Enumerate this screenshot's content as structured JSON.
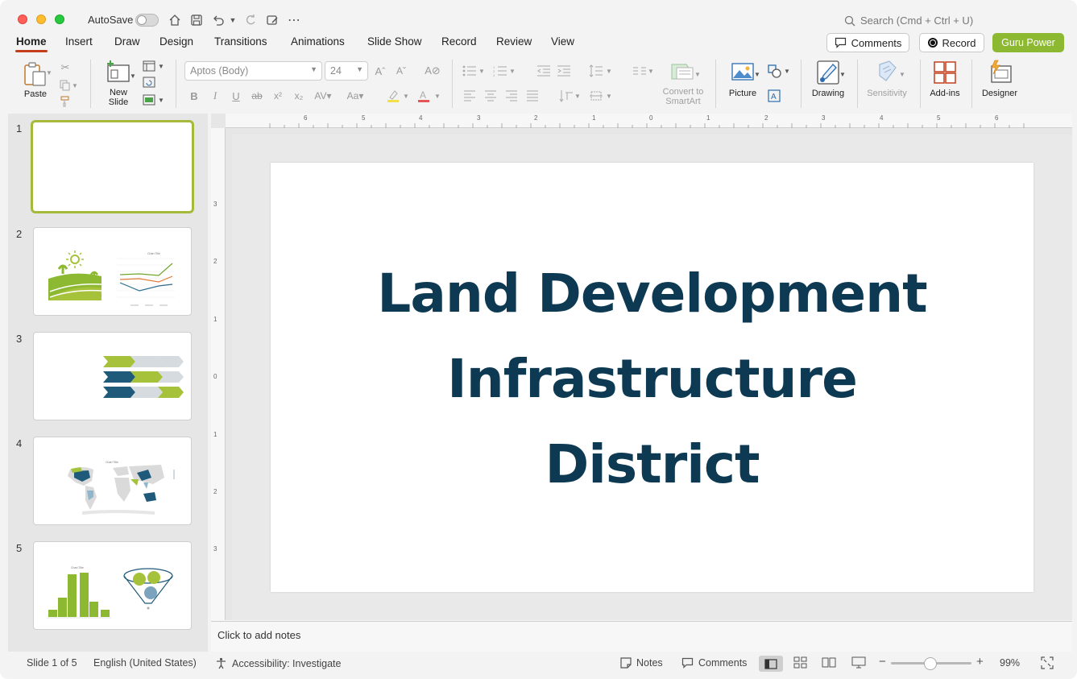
{
  "titlebar": {
    "autosave_label": "AutoSave",
    "search_placeholder": "Search (Cmd + Ctrl + U)"
  },
  "tabs": [
    {
      "label": "Home",
      "active": true
    },
    {
      "label": "Insert"
    },
    {
      "label": "Draw"
    },
    {
      "label": "Design"
    },
    {
      "label": "Transitions"
    },
    {
      "label": "Animations"
    },
    {
      "label": "Slide Show"
    },
    {
      "label": "Record"
    },
    {
      "label": "Review"
    },
    {
      "label": "View"
    }
  ],
  "header_buttons": {
    "comments": "Comments",
    "record": "Record",
    "guru": "Guru Power"
  },
  "ribbon": {
    "paste": "Paste",
    "new_slide_line1": "New",
    "new_slide_line2": "Slide",
    "font_name": "Aptos (Body)",
    "font_size": "24",
    "convert_line1": "Convert to",
    "convert_line2": "SmartArt",
    "picture": "Picture",
    "drawing": "Drawing",
    "sensitivity": "Sensitivity",
    "addins": "Add-ins",
    "designer": "Designer"
  },
  "ruler": {
    "h_labels": [
      "6",
      "5",
      "4",
      "3",
      "2",
      "1",
      "0",
      "1",
      "2",
      "3",
      "4",
      "5",
      "6"
    ],
    "v_labels": [
      "3",
      "2",
      "1",
      "0",
      "1",
      "2",
      "3"
    ]
  },
  "slides": [
    {
      "number": "1"
    },
    {
      "number": "2"
    },
    {
      "number": "3"
    },
    {
      "number": "4"
    },
    {
      "number": "5"
    }
  ],
  "slide": {
    "title_line1": "Land Development",
    "title_line2": "Infrastructure",
    "title_line3": "District"
  },
  "notes_placeholder": "Click to add notes",
  "status": {
    "slide_info": "Slide 1 of 5",
    "language": "English (United States)",
    "accessibility": "Accessibility: Investigate",
    "notes": "Notes",
    "comments": "Comments",
    "zoom": "99%"
  },
  "colors": {
    "accent_green": "#8cb832",
    "title_navy": "#0d3a52",
    "tab_underline": "#c43e1c"
  }
}
